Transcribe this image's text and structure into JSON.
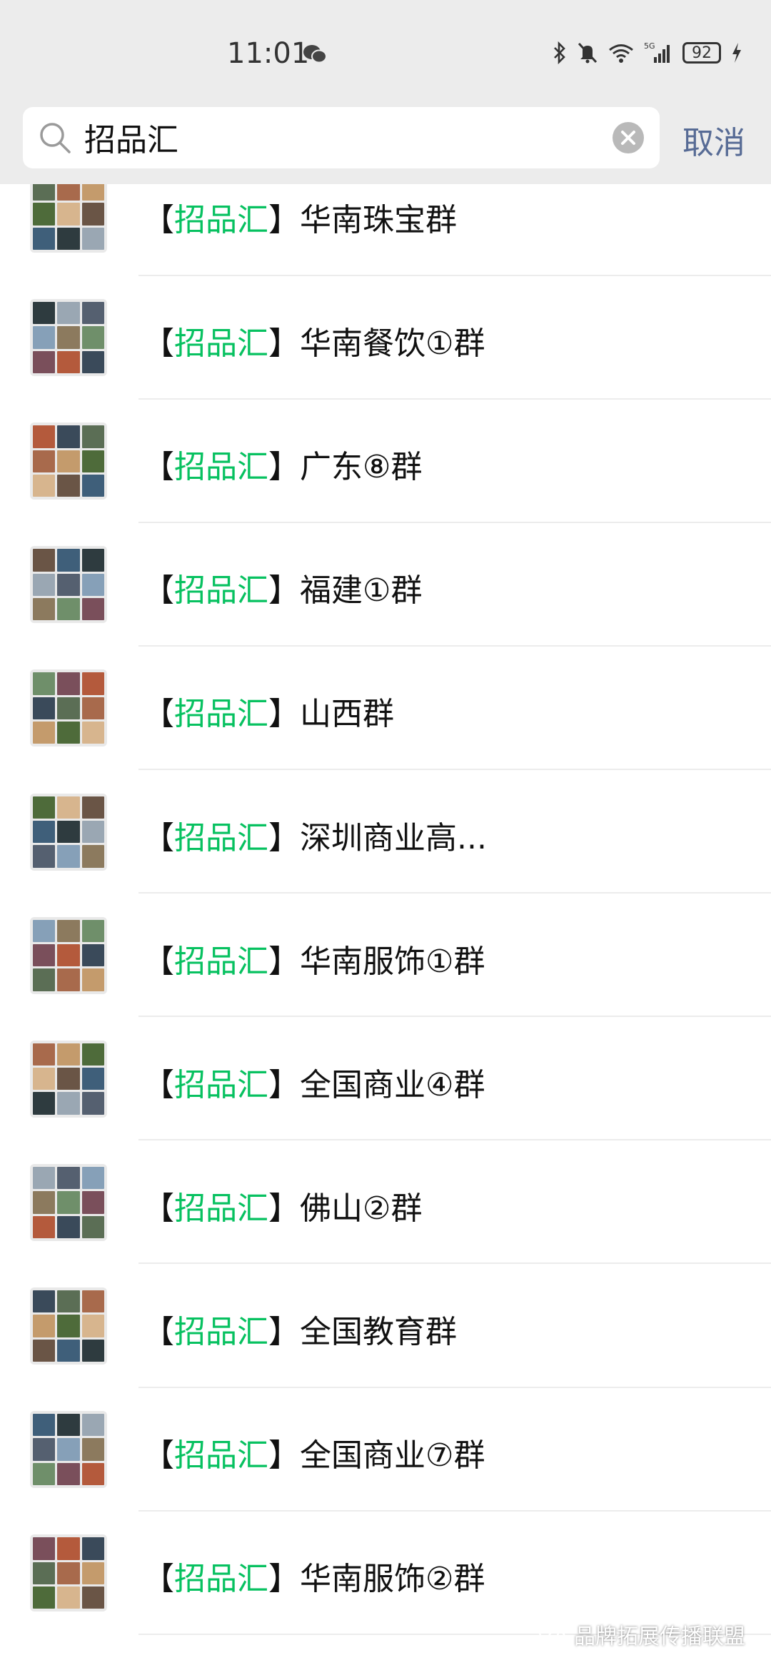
{
  "status_bar": {
    "time": "11:01",
    "battery": "92",
    "network": "5G"
  },
  "search": {
    "query": "招品汇",
    "cancel_label": "取消"
  },
  "results": [
    {
      "prefix_open": "【",
      "keyword": "招品汇",
      "prefix_close": "】",
      "name": "华南珠宝群"
    },
    {
      "prefix_open": "【",
      "keyword": "招品汇",
      "prefix_close": "】",
      "name": "华南餐饮①群"
    },
    {
      "prefix_open": "【",
      "keyword": "招品汇",
      "prefix_close": "】",
      "name": "广东⑧群"
    },
    {
      "prefix_open": "【",
      "keyword": "招品汇",
      "prefix_close": "】",
      "name": "福建①群"
    },
    {
      "prefix_open": "【",
      "keyword": "招品汇",
      "prefix_close": "】",
      "name": "山西群"
    },
    {
      "prefix_open": "【",
      "keyword": "招品汇",
      "prefix_close": "】",
      "name": "深圳商业高..."
    },
    {
      "prefix_open": "【",
      "keyword": "招品汇",
      "prefix_close": "】",
      "name": "华南服饰①群"
    },
    {
      "prefix_open": "【",
      "keyword": "招品汇",
      "prefix_close": "】",
      "name": "全国商业④群"
    },
    {
      "prefix_open": "【",
      "keyword": "招品汇",
      "prefix_close": "】",
      "name": "佛山②群"
    },
    {
      "prefix_open": "【",
      "keyword": "招品汇",
      "prefix_close": "】",
      "name": "全国教育群"
    },
    {
      "prefix_open": "【",
      "keyword": "招品汇",
      "prefix_close": "】",
      "name": "全国商业⑦群"
    },
    {
      "prefix_open": "【",
      "keyword": "招品汇",
      "prefix_close": "】",
      "name": "华南服饰②群"
    }
  ],
  "watermark": "品牌拓展传播联盟",
  "colors": {
    "keyword_highlight": "#07c160",
    "cancel": "#576b95",
    "header_bg": "#ececec"
  }
}
